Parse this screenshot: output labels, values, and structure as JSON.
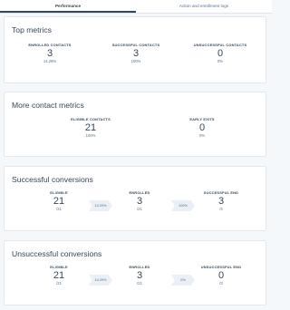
{
  "tabs": [
    {
      "label": "Performance",
      "active": true
    },
    {
      "label": "Action and enrollment logs",
      "active": false
    }
  ],
  "top_metrics": {
    "title": "Top metrics",
    "items": [
      {
        "label": "ENROLLED CONTACTS",
        "value": "3",
        "sub": "14.29%"
      },
      {
        "label": "SUCCESSFUL CONTACTS",
        "value": "3",
        "sub": "100%"
      },
      {
        "label": "UNSUCCESSFUL CONTACTS",
        "value": "0",
        "sub": "0%"
      }
    ]
  },
  "more_metrics": {
    "title": "More contact metrics",
    "items": [
      {
        "label": "ELIGIBLE CONTACTS",
        "value": "21",
        "sub": "100%"
      },
      {
        "label": "EARLY EXITS",
        "value": "0",
        "sub": "0%"
      }
    ]
  },
  "successful_conversions": {
    "title": "Successful conversions",
    "items": [
      {
        "label": "ELIGIBLE",
        "value": "21",
        "sub": "/21"
      },
      {
        "label": "ENROLLED",
        "value": "3",
        "sub": "/21"
      },
      {
        "label": "SUCCESSFUL END",
        "value": "3",
        "sub": "/3"
      }
    ],
    "rates": [
      "14.29%",
      "100%"
    ]
  },
  "unsuccessful_conversions": {
    "title": "Unsuccessful conversions",
    "items": [
      {
        "label": "ELIGIBLE",
        "value": "21",
        "sub": "/21"
      },
      {
        "label": "ENROLLED",
        "value": "3",
        "sub": "/21"
      },
      {
        "label": "UNSUCCESSFUL END",
        "value": "0",
        "sub": "/3"
      }
    ],
    "rates": [
      "14.29%",
      "0%"
    ]
  },
  "colors": {
    "background": "#f5f8fa",
    "card": "#ffffff",
    "text": "#33475b",
    "muted": "#516f90",
    "chevron": "#eaf0f6"
  }
}
